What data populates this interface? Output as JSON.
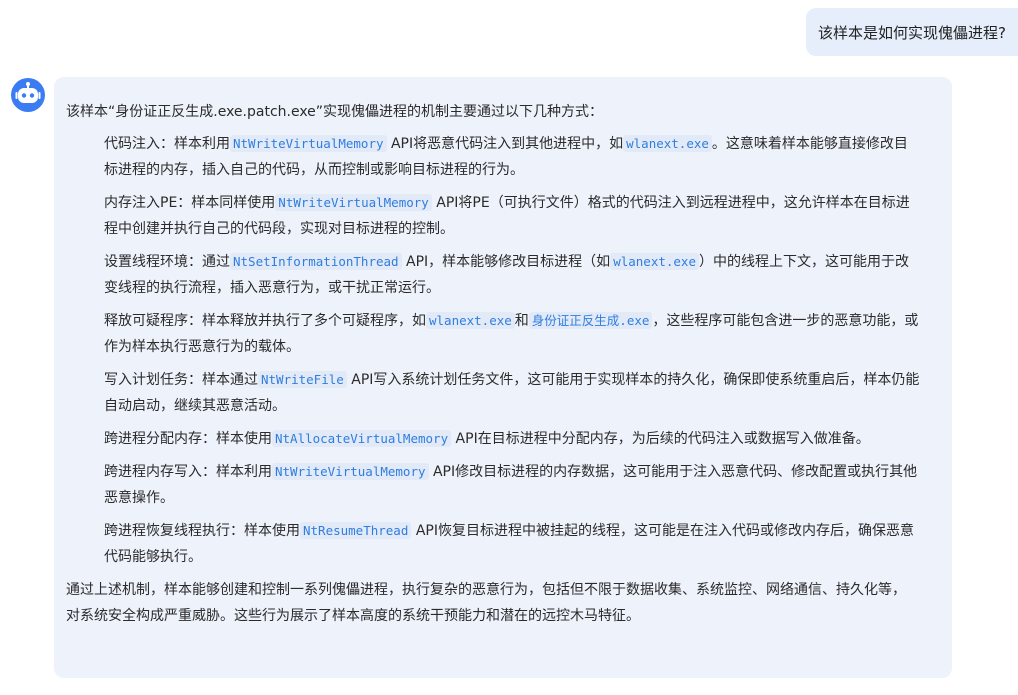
{
  "user_message": "该样本是如何实现傀儡进程?",
  "assistant": {
    "intro": "该样本“身份证正反生成.exe.patch.exe”实现傀儡进程的机制主要通过以下几种方式：",
    "items": [
      {
        "a": "代码注入：样本利用",
        "code1": "NtWriteVirtualMemory",
        "b": "API将恶意代码注入到其他进程中，如",
        "code2": "wlanext.exe",
        "c": "。这意味着样本能够直接修改目标进程的内存，插入自己的代码，从而控制或影响目标进程的行为。"
      },
      {
        "a": "内存注入PE：样本同样使用",
        "code1": "NtWriteVirtualMemory",
        "b": "API将PE（可执行文件）格式的代码注入到远程进程中，这允许样本在目标进程中创建并执行自己的代码段，实现对目标进程的控制。"
      },
      {
        "a": "设置线程环境：通过",
        "code1": "NtSetInformationThread",
        "b": "API，样本能够修改目标进程（如",
        "code2": "wlanext.exe",
        "c": "）中的线程上下文，这可能用于改变线程的执行流程，插入恶意行为，或干扰正常运行。"
      },
      {
        "a": "释放可疑程序：样本释放并执行了多个可疑程序，如",
        "code1": "wlanext.exe",
        "b": "和",
        "code2": "身份证正反生成.exe",
        "c": "，这些程序可能包含进一步的恶意功能，或作为样本执行恶意行为的载体。"
      },
      {
        "a": "写入计划任务：样本通过",
        "code1": "NtWriteFile",
        "b": "API写入系统计划任务文件，这可能用于实现样本的持久化，确保即使系统重启后，样本仍能自动启动，继续其恶意活动。"
      },
      {
        "a": "跨进程分配内存：样本使用",
        "code1": "NtAllocateVirtualMemory",
        "b": "API在目标进程中分配内存，为后续的代码注入或数据写入做准备。"
      },
      {
        "a": "跨进程内存写入：样本利用",
        "code1": "NtWriteVirtualMemory",
        "b": "API修改目标进程的内存数据，这可能用于注入恶意代码、修改配置或执行其他恶意操作。"
      },
      {
        "a": "跨进程恢复线程执行：样本使用",
        "code1": "NtResumeThread",
        "b": "API恢复目标进程中被挂起的线程，这可能是在注入代码或修改内存后，确保恶意代码能够执行。"
      }
    ],
    "outro": "通过上述机制，样本能够创建和控制一系列傀儡进程，执行复杂的恶意行为，包括但不限于数据收集、系统监控、网络通信、持久化等，对系统安全构成严重威胁。这些行为展示了样本高度的系统干预能力和潜在的远控木马特征。"
  },
  "colors": {
    "user_bubble": "#e7eefb",
    "assistant_bubble": "#edf2fb",
    "avatar": "#3c7cf2",
    "code_text": "#2f7de0"
  },
  "icons": {
    "avatar": "robot-icon"
  }
}
